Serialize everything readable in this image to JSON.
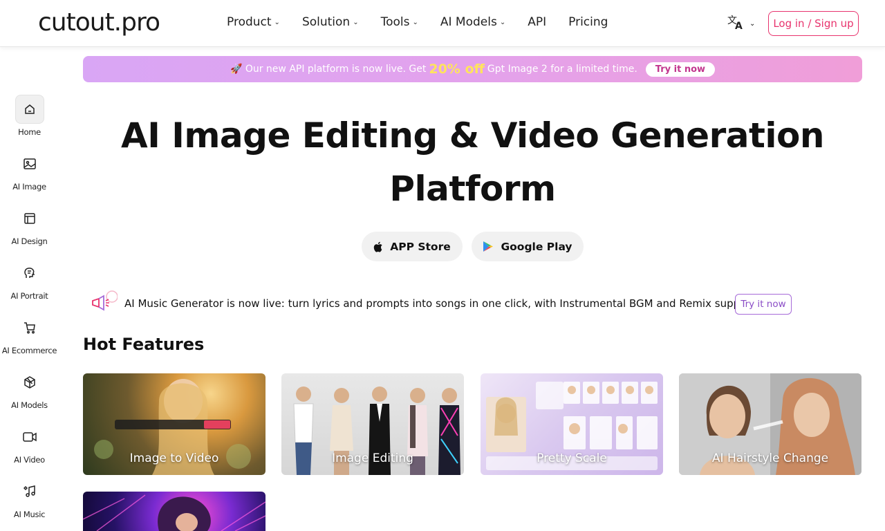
{
  "header": {
    "logo": "cutout.pro",
    "nav": [
      {
        "label": "Product",
        "has_dropdown": true
      },
      {
        "label": "Solution",
        "has_dropdown": true
      },
      {
        "label": "Tools",
        "has_dropdown": true
      },
      {
        "label": "AI Models",
        "has_dropdown": true
      },
      {
        "label": "API",
        "has_dropdown": false
      },
      {
        "label": "Pricing",
        "has_dropdown": false
      }
    ],
    "language_icon": "translate-icon",
    "login_label": "Log in / Sign up"
  },
  "promo": {
    "prefix": "🚀 Our new API platform is now live. Get",
    "highlight": "20% off",
    "suffix": "Gpt Image 2 for a limited time.",
    "try_label": "Try it now"
  },
  "sidebar": {
    "items": [
      {
        "label": "Home",
        "icon": "home-icon"
      },
      {
        "label": "AI Image",
        "icon": "image-icon"
      },
      {
        "label": "AI Design",
        "icon": "layout-icon"
      },
      {
        "label": "AI Portrait",
        "icon": "portrait-icon"
      },
      {
        "label": "AI Ecommerce",
        "icon": "cart-icon"
      },
      {
        "label": "AI Models",
        "icon": "cube-icon"
      },
      {
        "label": "AI Video",
        "icon": "video-icon"
      },
      {
        "label": "AI Music",
        "icon": "music-icon"
      }
    ]
  },
  "hero": {
    "title_line1": "AI Image Editing & Video Generation",
    "title_line2": "Platform",
    "app_store_label": "APP Store",
    "google_play_label": "Google Play"
  },
  "notice": {
    "text": "AI Music Generator is now live: turn lyrics and prompts into songs in one click, with Instrumental BGM and Remix support.",
    "try_label": "Try it now"
  },
  "hot_features": {
    "title": "Hot Features",
    "cards": [
      {
        "label": "Image to Video"
      },
      {
        "label": "Image Editing"
      },
      {
        "label": "Pretty Scale"
      },
      {
        "label": "AI Hairstyle Change"
      },
      {
        "label": ""
      }
    ]
  },
  "colors": {
    "accent": "#e8336d",
    "notice_accent": "#8a4cc6",
    "promo_highlight": "#ffe45c"
  }
}
